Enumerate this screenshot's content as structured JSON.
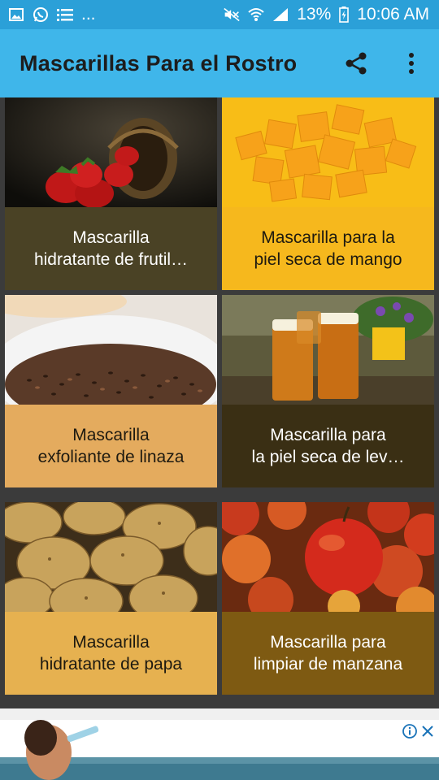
{
  "status_bar": {
    "left_icons": [
      "image-icon",
      "whatsapp-icon",
      "list-icon"
    ],
    "ellipsis": "...",
    "battery": "13%",
    "time": "10:06 AM"
  },
  "app_bar": {
    "title": "Mascarillas Para el Rostro",
    "actions": [
      "share-icon",
      "more-vert-icon"
    ]
  },
  "cards": [
    {
      "line1": "Mascarilla",
      "line2": "hidratante de frutil…",
      "caption_bg": "#4a4225",
      "image": "strawberries"
    },
    {
      "line1": "Mascarilla para la",
      "line2": "piel seca de mango",
      "caption_bg": "#f6b81d",
      "image": "mango"
    },
    {
      "line1": "Mascarilla",
      "line2": "exfoliante de linaza",
      "caption_bg": "#e4ab5e",
      "image": "flaxseed"
    },
    {
      "line1": "Mascarilla para",
      "line2": "la piel seca de lev…",
      "caption_bg": "#3a2f14",
      "image": "beer"
    },
    {
      "line1": "Mascarilla",
      "line2": "hidratante de papa",
      "caption_bg": "#e6b150",
      "image": "potato"
    },
    {
      "line1": "Mascarilla para",
      "line2": "limpiar de manzana",
      "caption_bg": "#7e5a12",
      "image": "apple"
    }
  ],
  "ad": {
    "badges": [
      "info-icon",
      "close-icon"
    ]
  }
}
